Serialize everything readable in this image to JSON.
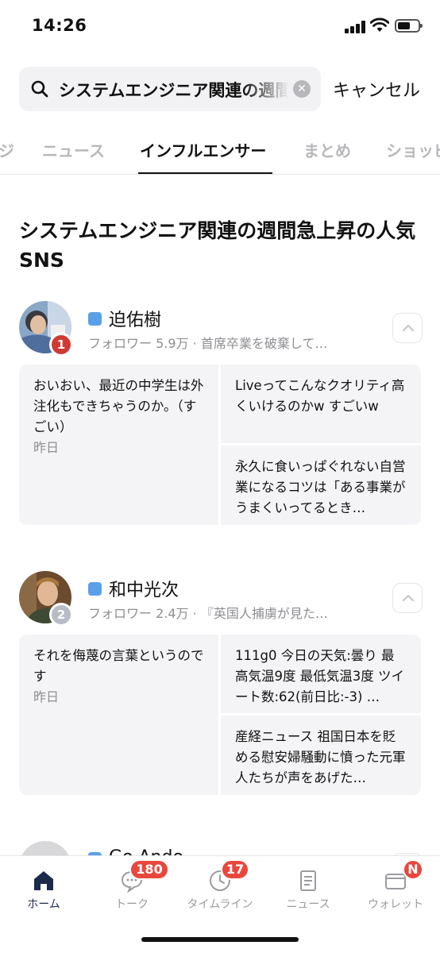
{
  "status_bar": {
    "time": "14:26"
  },
  "search": {
    "query": "システムエンジニア関連の週間急上昇",
    "cancel_label": "キャンセル"
  },
  "tabs": [
    {
      "label": "ジ"
    },
    {
      "label": "ニュース"
    },
    {
      "label": "インフルエンサー",
      "active": true
    },
    {
      "label": "まとめ"
    },
    {
      "label": "ショッピ"
    }
  ],
  "section": {
    "title": "システムエンジニア関連の週間急上昇の人気SNS"
  },
  "influencers": [
    {
      "rank": "1",
      "rank_color": "#d03a34",
      "name": "迫佑樹",
      "followers": "フォロワー 5.9万",
      "bio": "首席卒業を破棄して…",
      "posts": [
        {
          "text": "おいおい、最近の中学生は外注化もできちゃうのか。（すごい）",
          "date": "昨日"
        },
        {
          "text": "Liveってこんなクオリティ高くいけるのかw すごいw"
        },
        {
          "text": "永久に食いっぱぐれない自営業になるコツは「ある事業がうまくいってるとき…"
        }
      ]
    },
    {
      "rank": "2",
      "rank_color": "#b8bcc6",
      "name": "和中光次",
      "followers": "フォロワー 2.4万",
      "bio": "『英国人捕虜が見た…",
      "posts": [
        {
          "text": "それを侮蔑の言葉というのです",
          "date": "昨日"
        },
        {
          "text": "111g0 今日の天気:曇り 最高気温9度 最低気温3度 ツイート数:62(前日比:-3) …"
        },
        {
          "text": "産経ニュース 祖国日本を貶める慰安婦騒動に憤った元軍人たちが声をあげた…"
        }
      ]
    },
    {
      "name": "Go Ando"
    }
  ],
  "bottom_nav": [
    {
      "label": "ホーム",
      "icon": "home-icon",
      "active": true
    },
    {
      "label": "トーク",
      "icon": "chat-icon",
      "badge": "180"
    },
    {
      "label": "タイムライン",
      "icon": "clock-icon",
      "badge": "17"
    },
    {
      "label": "ニュース",
      "icon": "news-icon"
    },
    {
      "label": "ウォレット",
      "icon": "wallet-icon",
      "badge": "N"
    }
  ],
  "colors": {
    "accent": "#1c2b4a",
    "badge": "#e8473e",
    "verified": "#5aa0e8"
  }
}
